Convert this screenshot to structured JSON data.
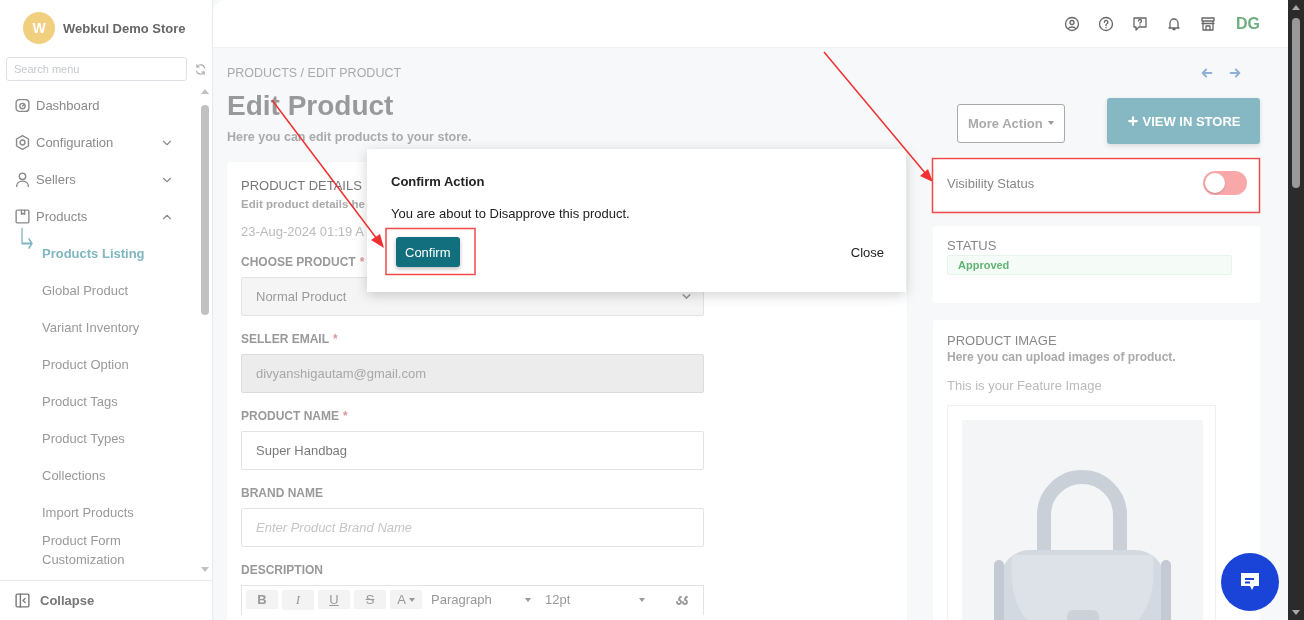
{
  "sidebar": {
    "logo_letter": "W",
    "store_name": "Webkul Demo Store",
    "search": {
      "placeholder": "Search menu"
    },
    "items": [
      {
        "kind": "link",
        "label": "Dashboard"
      },
      {
        "kind": "group",
        "label": "Configuration",
        "expanded": false
      },
      {
        "kind": "group",
        "label": "Sellers",
        "expanded": false
      },
      {
        "kind": "group",
        "label": "Products",
        "expanded": true,
        "children": [
          {
            "label": "Products Listing",
            "selected": true
          },
          {
            "label": "Global Product",
            "selected": false
          },
          {
            "label": "Variant Inventory",
            "selected": false
          },
          {
            "label": "Product Option",
            "selected": false
          },
          {
            "label": "Product Tags",
            "selected": false
          },
          {
            "label": "Product Types",
            "selected": false
          },
          {
            "label": "Collections",
            "selected": false
          },
          {
            "label": "Import Products",
            "selected": false
          },
          {
            "label": "Product Form Customization",
            "selected": false
          }
        ]
      }
    ],
    "collapse": "Collapse"
  },
  "header": {
    "avatar_initials": "DG"
  },
  "page": {
    "breadcrumb": "PRODUCTS / EDIT PRODUCT",
    "title": "Edit Product",
    "subtitle": "Here you can edit products to your store."
  },
  "details": {
    "title": "PRODUCT DETAILS",
    "subtitle": "Edit product details he",
    "date": "23-Aug-2024 01:19 A",
    "fields": [
      {
        "kind": "select",
        "label": "CHOOSE PRODUCT",
        "required_mark": "*",
        "value": "Normal Product"
      },
      {
        "kind": "input",
        "label": "SELLER EMAIL",
        "required_mark": "*",
        "disabled": true,
        "value": "divyanshigautam@gmail.com"
      },
      {
        "kind": "input",
        "label": "PRODUCT NAME",
        "required_mark": "*",
        "disabled": false,
        "value": "Super Handbag"
      },
      {
        "kind": "input",
        "label": "BRAND NAME",
        "disabled": false,
        "placeholder": "Enter Product Brand Name"
      },
      {
        "kind": "editor",
        "label": "DESCRIPTION",
        "toolbar": [
          {
            "kind": "bold",
            "label": "B"
          },
          {
            "kind": "italic",
            "label": "I"
          },
          {
            "kind": "underline",
            "label": "U"
          },
          {
            "kind": "strike",
            "label": "S"
          },
          {
            "kind": "color",
            "label": "A"
          },
          {
            "kind": "dropdown",
            "label": "Paragraph"
          },
          {
            "kind": "dropdown",
            "label": "12pt"
          },
          {
            "kind": "quote"
          }
        ]
      }
    ]
  },
  "actions": {
    "more_action": "More Action",
    "view_in_store": "VIEW IN STORE"
  },
  "visibility": {
    "label": "Visibility Status",
    "on": false
  },
  "status": {
    "label": "STATUS",
    "badge": "Approved"
  },
  "product_image": {
    "title": "PRODUCT IMAGE",
    "subtitle": "Here you can upload images of product.",
    "feature_label": "This is your Feature Image"
  },
  "dialog": {
    "title": "Confirm Action",
    "message": "You are about to Disapprove this product.",
    "confirm": "Confirm",
    "close": "Close"
  }
}
